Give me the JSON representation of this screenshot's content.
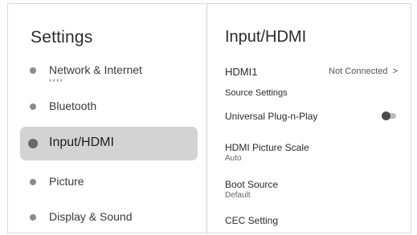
{
  "sidebar": {
    "title": "Settings",
    "items": [
      {
        "label": "Network & Internet",
        "sub": "****"
      },
      {
        "label": "Bluetooth"
      },
      {
        "label": "Input/HDMI"
      },
      {
        "label": "Picture"
      },
      {
        "label": "Display & Sound"
      }
    ],
    "selected_index": 2
  },
  "panel": {
    "title": "Input/HDMI",
    "hdmi1": {
      "label": "HDMI1",
      "status": "Not Connected",
      "chevron": ">"
    },
    "source_settings": "Source Settings",
    "plug_n_play": {
      "label": "Universal Plug-n-Play",
      "enabled": false
    },
    "picture_scale": {
      "label": "HDMI Picture Scale",
      "value": "Auto"
    },
    "boot_source": {
      "label": "Boot Source",
      "value": "Default"
    },
    "cec": {
      "label": "CEC Setting"
    }
  },
  "colors": {
    "selected_bg": "#d3d3d3",
    "divider": "#d6d6d6",
    "toggle_track": "#bdbdbd",
    "toggle_knob": "#4a4a4a"
  }
}
